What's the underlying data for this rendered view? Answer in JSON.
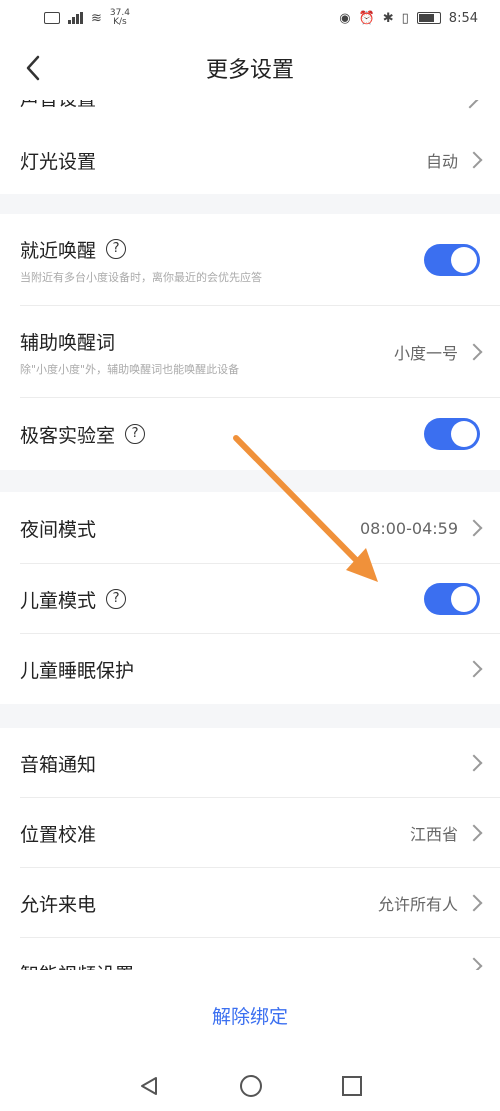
{
  "status_bar": {
    "net_speed_top": "37.4",
    "net_speed_bottom": "K/s",
    "time": "8:54"
  },
  "header": {
    "title": "更多设置"
  },
  "cut_row": {
    "label": "声音设置"
  },
  "sections": {
    "light": {
      "label": "灯光设置",
      "value": "自动"
    },
    "nearby_wake": {
      "label": "就近唤醒",
      "description": "当附近有多台小度设备时，离你最近的会优先应答",
      "enabled": true
    },
    "aux_wake_word": {
      "label": "辅助唤醒词",
      "description": "除\"小度小度\"外，辅助唤醒词也能唤醒此设备",
      "value": "小度一号"
    },
    "geek_lab": {
      "label": "极客实验室",
      "enabled": true
    },
    "night_mode": {
      "label": "夜间模式",
      "value": "08:00-04:59"
    },
    "kids_mode": {
      "label": "儿童模式",
      "enabled": true
    },
    "kids_sleep": {
      "label": "儿童睡眠保护"
    },
    "speaker_notify": {
      "label": "音箱通知"
    },
    "location": {
      "label": "位置校准",
      "value": "江西省"
    },
    "allow_calls": {
      "label": "允许来电",
      "value": "允许所有人"
    },
    "smart_video": {
      "label": "智能视频设置"
    }
  },
  "unbind_label": "解除绑定",
  "colors": {
    "accent": "#3b6ff0",
    "annotation_arrow": "#f0913a"
  },
  "icons": [
    "back-arrow-icon",
    "help-icon",
    "chevron-right-icon",
    "sys-back-icon",
    "sys-home-icon",
    "sys-recent-icon"
  ]
}
